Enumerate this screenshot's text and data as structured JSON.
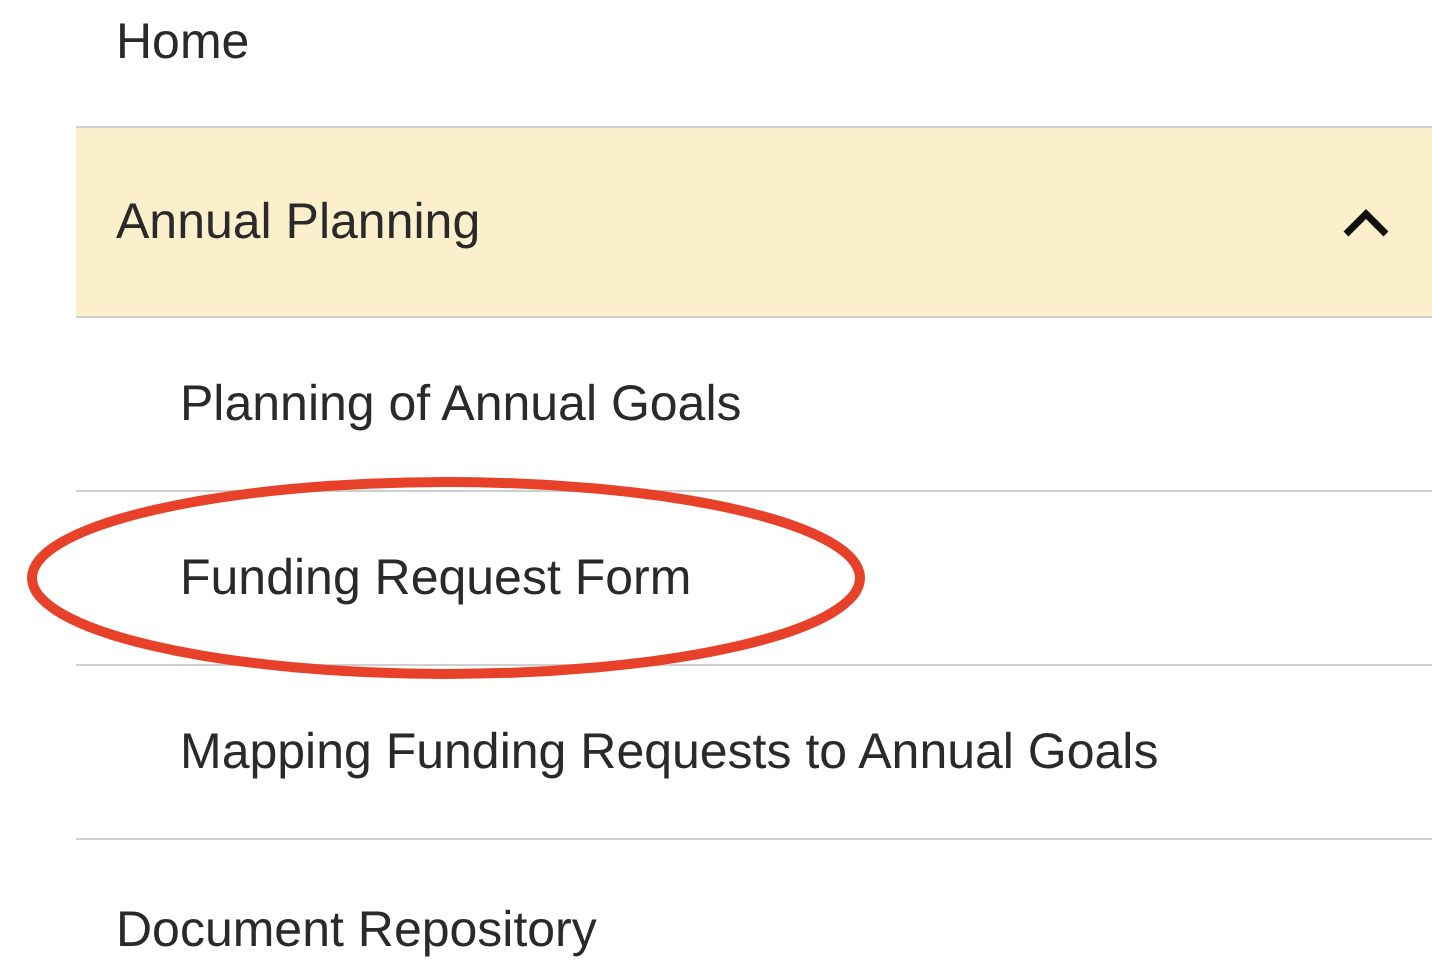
{
  "nav": {
    "items": [
      {
        "label": "Home",
        "selected": false
      },
      {
        "label": "Annual Planning",
        "selected": true,
        "expanded": true,
        "children": [
          {
            "label": "Planning of Annual Goals",
            "circled": false
          },
          {
            "label": "Funding Request Form",
            "circled": true
          },
          {
            "label": "Mapping Funding Requests to Annual Goals",
            "circled": false
          }
        ]
      },
      {
        "label": "Document Repository",
        "selected": false
      }
    ]
  }
}
